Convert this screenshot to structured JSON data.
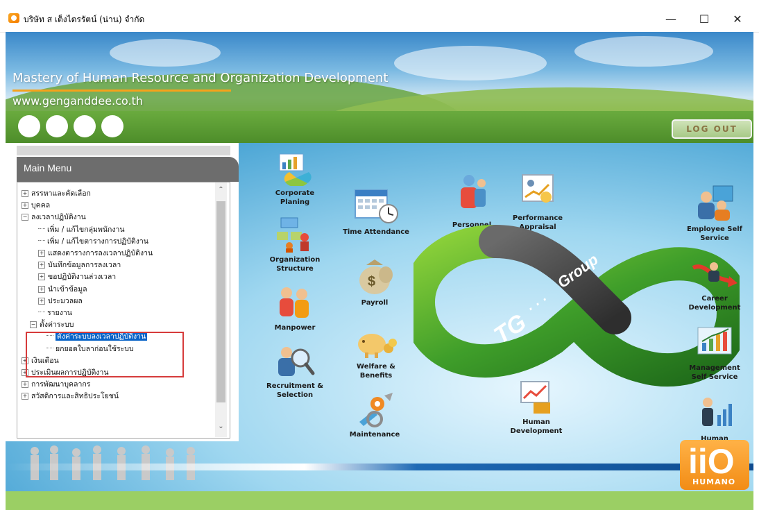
{
  "window": {
    "title": "บริษัท ส เต็งไตรรัตน์ (น่าน) จำกัด",
    "controls": {
      "minimize": "—",
      "maximize": "☐",
      "close": "✕"
    }
  },
  "banner": {
    "title": "Mastery of Human Resource and Organization Development",
    "url": "www.genganddee.co.th",
    "logout_label": "LOG OUT"
  },
  "menu": {
    "header": "Main Menu",
    "items": [
      {
        "label": "สรรหาและคัดเลือก",
        "expander": "+"
      },
      {
        "label": "บุคคล",
        "expander": "+"
      },
      {
        "label": "ลงเวลาปฏิบัติงาน",
        "expander": "−"
      },
      {
        "label": "เพิ่ม / แก้ไขกลุ่มพนักงาน",
        "expander": ""
      },
      {
        "label": "เพิ่ม / แก้ไขตารางการปฏิบัติงาน",
        "expander": ""
      },
      {
        "label": "แสดงตารางการลงเวลาปฏิบัติงาน",
        "expander": "+"
      },
      {
        "label": "บันทึกข้อมูลการลงเวลา",
        "expander": "+"
      },
      {
        "label": "ขอปฏิบัติงานล่วงเวลา",
        "expander": "+"
      },
      {
        "label": "นำเข้าข้อมูล",
        "expander": "+"
      },
      {
        "label": "ประมวลผล",
        "expander": "+"
      },
      {
        "label": "รายงาน",
        "expander": ""
      },
      {
        "label": "ตั้งค่าระบบ",
        "expander": "−"
      },
      {
        "label": "ตั้งค่าระบบลงเวลาปฏิบัติงาน",
        "expander": ""
      },
      {
        "label": "ยกยอดใบลาก่อนใช้ระบบ",
        "expander": ""
      },
      {
        "label": "เงินเดือน",
        "expander": "+"
      },
      {
        "label": "ประเมินผลการปฏิบัติงาน",
        "expander": "+"
      },
      {
        "label": "การพัฒนาบุคลากร",
        "expander": "+"
      },
      {
        "label": "สวัสดิการและสิทธิประโยชน์",
        "expander": "+"
      }
    ],
    "selected_index": 12
  },
  "modules": {
    "corporate_planing": "Corporate Planing",
    "organization_structure": "Organization Structure",
    "manpower": "Manpower",
    "recruitment": "Recruitment & Selection",
    "time_attendance": "Time Attendance",
    "payroll": "Payroll",
    "welfare": "Welfare & Benefits",
    "maintenance": "Maintenance",
    "personnel": "Personnel",
    "performance": "Performance Appraisal",
    "human_development": "Human Development",
    "employee_self_service": "Employee Self Service",
    "career_development": "Career Development",
    "management_self_service": "Management Self Service",
    "human": "Human"
  },
  "logo": {
    "center_text_tg": "TG",
    "center_text_group": "Group",
    "center_dots": "· · ·",
    "brand_big": "iiO",
    "brand_small": "HUMANO"
  },
  "colors": {
    "accent_orange": "#f6a21a",
    "menu_header": "#6d6d6d",
    "selection_blue": "#0a64c8",
    "highlight_red": "#d63b3b",
    "green_bar": "#5a9c33"
  }
}
